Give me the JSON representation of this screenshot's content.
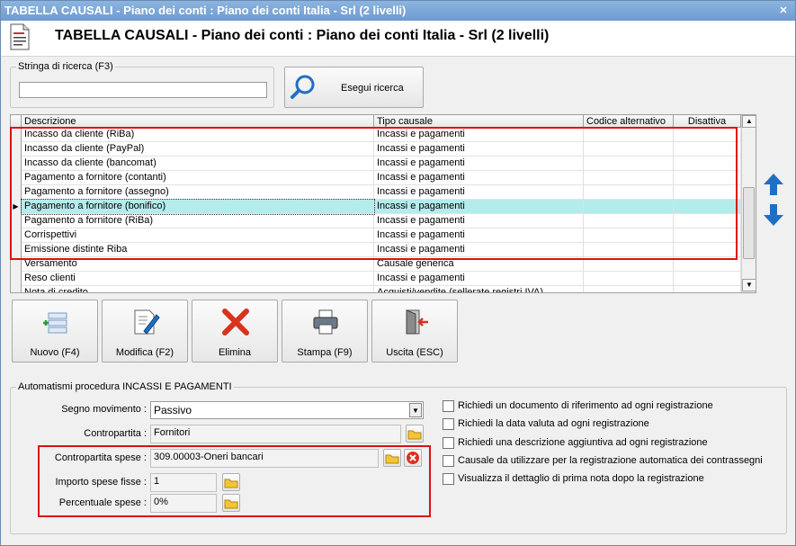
{
  "window": {
    "title": "TABELLA CAUSALI - Piano dei conti : Piano dei conti Italia - Srl (2 livelli)",
    "close_label": "✕"
  },
  "header": {
    "title": "TABELLA CAUSALI - Piano dei conti : Piano dei conti Italia - Srl (2 livelli)"
  },
  "search": {
    "group_label": "Stringa di ricerca (F3)",
    "value": "",
    "button_label": "Esegui ricerca"
  },
  "grid": {
    "columns": [
      "Descrizione",
      "Tipo causale",
      "Codice alternativo",
      "Disattiva"
    ],
    "rows": [
      {
        "descrizione": "Incasso da cliente (RiBa)",
        "tipo": "Incassi e pagamenti"
      },
      {
        "descrizione": "Incasso da cliente (PayPal)",
        "tipo": "Incassi e pagamenti"
      },
      {
        "descrizione": "Incasso da cliente (bancomat)",
        "tipo": "Incassi e pagamenti"
      },
      {
        "descrizione": "Pagamento a fornitore (contanti)",
        "tipo": "Incassi e pagamenti"
      },
      {
        "descrizione": "Pagamento a fornitore (assegno)",
        "tipo": "Incassi e pagamenti"
      },
      {
        "descrizione": "Pagamento a fornitore (bonifico)",
        "tipo": "Incassi e pagamenti"
      },
      {
        "descrizione": "Pagamento a fornitore (RiBa)",
        "tipo": "Incassi e pagamenti"
      },
      {
        "descrizione": "Corrispettivi",
        "tipo": "Incassi e pagamenti"
      },
      {
        "descrizione": "Emissione distinte Riba",
        "tipo": "Incassi e pagamenti"
      },
      {
        "descrizione": "Versamento",
        "tipo": "Causale generica"
      },
      {
        "descrizione": "Reso clienti",
        "tipo": "Incassi e pagamenti"
      },
      {
        "descrizione": "Nota di credito",
        "tipo": "Acquisti/vendite (sellerate registri IVA)"
      }
    ],
    "selected_index": 5
  },
  "toolbar": {
    "nuovo": "Nuovo (F4)",
    "modifica": "Modifica (F2)",
    "elimina": "Elimina",
    "stampa": "Stampa (F9)",
    "uscita": "Uscita (ESC)"
  },
  "auto": {
    "group_label": "Automatismi procedura INCASSI E PAGAMENTI",
    "segno_label": "Segno movimento :",
    "segno_value": "Passivo",
    "contropartita_label": "Contropartita :",
    "contropartita_value": "Fornitori",
    "spese_label": "Contropartita spese :",
    "spese_value": "309.00003-Oneri bancari",
    "importo_label": "Importo spese fisse :",
    "importo_value": "1",
    "perc_label": "Percentuale spese :",
    "perc_value": "0%",
    "checks": [
      "Richiedi un documento di riferimento ad ogni registrazione",
      "Richiedi la data valuta ad ogni registrazione",
      "Richiedi una descrizione aggiuntiva ad ogni registrazione",
      "Causale da utilizzare per la registrazione automatica dei contrassegni",
      "Visualizza il dettaglio di prima nota dopo la registrazione"
    ]
  },
  "colors": {
    "accent": "#1f6fc5",
    "highlight": "#e01010",
    "selection": "#b4ecec"
  }
}
